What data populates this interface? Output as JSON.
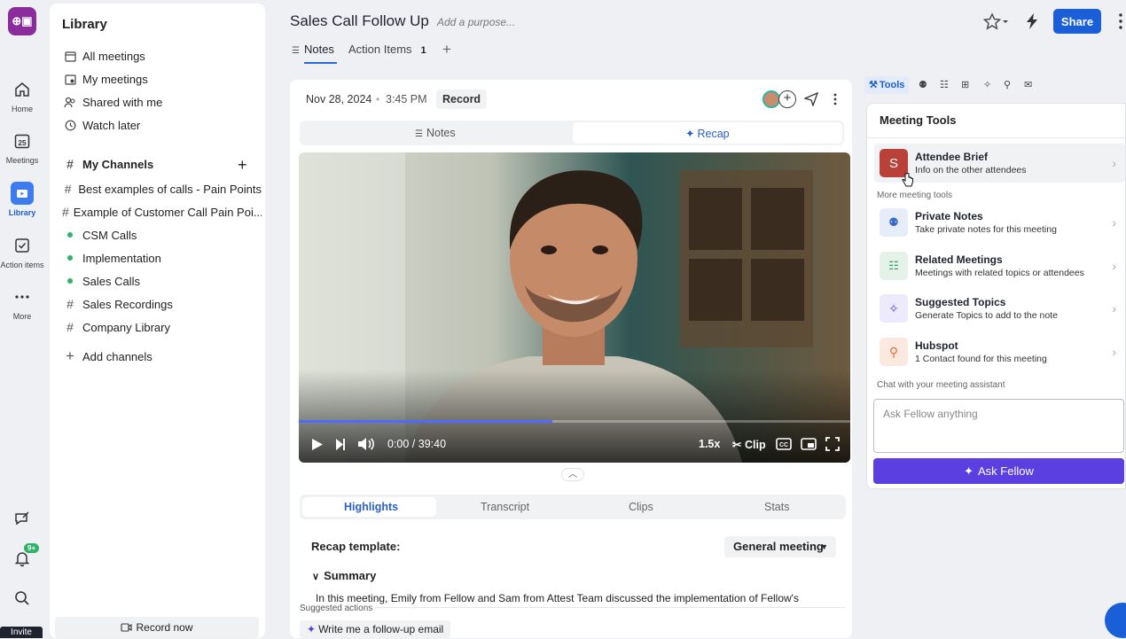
{
  "rail": {
    "items": [
      {
        "label": "Home",
        "icon": "home-icon"
      },
      {
        "label": "Meetings",
        "icon": "calendar-icon",
        "day": "25"
      },
      {
        "label": "Library",
        "icon": "library-icon"
      },
      {
        "label": "Action items",
        "icon": "checkbox-icon"
      },
      {
        "label": "More",
        "icon": "more-icon"
      }
    ],
    "notification_badge": "9+",
    "invite_label": "Invite"
  },
  "library": {
    "title": "Library",
    "nav": [
      "All meetings",
      "My meetings",
      "Shared with me",
      "Watch later"
    ],
    "channels_title": "My Channels",
    "channels": [
      {
        "name": "Best examples of calls - Pain Points",
        "marker": "#"
      },
      {
        "name": "Example of Customer Call Pain Poi...",
        "marker": "#"
      },
      {
        "name": "CSM Calls",
        "marker": "dot"
      },
      {
        "name": "Implementation",
        "marker": "dot"
      },
      {
        "name": "Sales Calls",
        "marker": "dot"
      },
      {
        "name": "Sales Recordings",
        "marker": "#"
      },
      {
        "name": "Company Library",
        "marker": "#"
      }
    ],
    "add_channels": "Add channels",
    "record_now": "Record now"
  },
  "header": {
    "title": "Sales Call Follow Up",
    "purpose_placeholder": "Add a purpose...",
    "tabs": [
      {
        "label": "Notes"
      },
      {
        "label": "Action Items",
        "count": "1"
      }
    ],
    "share_label": "Share",
    "accent": "#1a5fd8"
  },
  "meeting": {
    "date": "Nov 28, 2024",
    "time": "3:45 PM",
    "record_label": "Record",
    "seg_notes": "Notes",
    "seg_recap": "Recap",
    "video": {
      "time": "0:00 / 39:40",
      "speed": "1.5x",
      "clip": "Clip",
      "progress": 0.46
    },
    "bottom_tabs": [
      "Highlights",
      "Transcript",
      "Clips",
      "Stats"
    ],
    "recap_template_label": "Recap template:",
    "recap_template_value": "General meeting",
    "summary_title": "Summary",
    "summary_text": "In this meeting, Emily from Fellow and Sam from Attest Team discussed the implementation of Fellow's",
    "suggested_actions_label": "Suggested actions",
    "suggested_action": "Write me a follow-up email"
  },
  "tools": {
    "tab_label": "Tools",
    "panel_title": "Meeting Tools",
    "top_item": {
      "title": "Attendee Brief",
      "subtitle": "Info on the other attendees",
      "avatar": "S"
    },
    "more_label": "More meeting tools",
    "items": [
      {
        "title": "Private Notes",
        "subtitle": "Take private notes for this meeting",
        "icon": "private-notes-icon"
      },
      {
        "title": "Related Meetings",
        "subtitle": "Meetings with related topics or attendees",
        "icon": "related-meetings-icon"
      },
      {
        "title": "Suggested Topics",
        "subtitle": "Generate Topics to add to the note",
        "icon": "sparkle-icon"
      },
      {
        "title": "Hubspot",
        "subtitle": "1 Contact found for this meeting",
        "icon": "hubspot-icon"
      }
    ],
    "chat_label": "Chat with your meeting assistant",
    "ask_placeholder": "Ask Fellow anything",
    "ask_button": "Ask Fellow"
  }
}
